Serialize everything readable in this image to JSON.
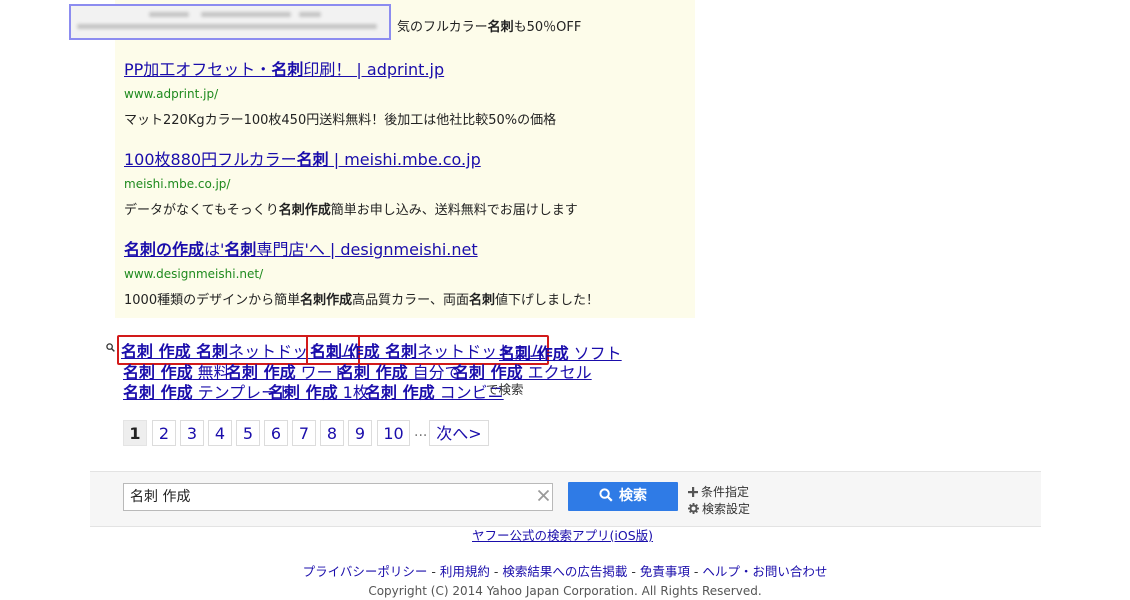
{
  "ads": {
    "first_tail": [
      "気のフルカラー",
      "名刺",
      "も50％OFF"
    ],
    "items": [
      {
        "title": [
          "PP加工オフセット・",
          "名刺",
          "印刷！ | adprint.jp"
        ],
        "url": "www.adprint.jp/",
        "desc": [
          "マット220Kgカラー100枚450円送料無料！後加工は他社比較50%の価格"
        ]
      },
      {
        "title": [
          "100枚880円フルカラー",
          "名刺",
          " | meishi.mbe.co.jp"
        ],
        "url": "meishi.mbe.co.jp/",
        "desc": [
          "データがなくてもそっくり",
          "名刺作成",
          "簡単お申し込み、送料無料でお届けします"
        ]
      },
      {
        "title": [
          "",
          "名刺の作成",
          "は'",
          "名刺",
          "専門店'へ | designmeishi.net"
        ],
        "url": "www.designmeishi.net/",
        "desc": [
          "1000種類のデザインから簡単",
          "名刺作成",
          "高品質カラー、両面",
          "名刺",
          "値下げしました！"
        ]
      }
    ]
  },
  "related": {
    "links": [
      {
        "bold": "名刺 作成 名刺",
        "rest": "ネットドットコム"
      },
      {
        "bold": "名刺 作成 名刺",
        "rest": "ネットドットコム"
      },
      {
        "bold": "名刺 作成",
        "rest": " ソフト"
      },
      {
        "bold": "名刺 作成",
        "rest": " 無料"
      },
      {
        "bold": "名刺 作成",
        "rest": " ワード"
      },
      {
        "bold": "名刺 作成",
        "rest": " 自分で"
      },
      {
        "bold": "名刺 作成",
        "rest": " エクセル"
      },
      {
        "bold": "名刺 作成",
        "rest": " テンプレート"
      },
      {
        "bold": "名刺 作成",
        "rest": " 1枚"
      },
      {
        "bold": "名刺 作成",
        "rest": " コンビニ"
      }
    ],
    "suffix": "で検索"
  },
  "pager": {
    "pages": [
      "1",
      "2",
      "3",
      "4",
      "5",
      "6",
      "7",
      "8",
      "9",
      "10"
    ],
    "current": "1",
    "dots": "...",
    "next": "次へ>"
  },
  "search": {
    "value": "名刺 作成",
    "button_label": "検索",
    "conditions_label": "条件指定",
    "settings_label": "検索設定",
    "accent_color": "#2f7be6"
  },
  "app_link": "ヤフー公式の検索アプリ(iOS版)",
  "footer": {
    "links": [
      "プライバシーポリシー",
      "利用規約",
      "検索結果への広告掲載",
      "免責事項",
      "ヘルプ・お問い合わせ"
    ],
    "separator": " - ",
    "copyright": "Copyright (C) 2014 Yahoo Japan Corporation. All Rights Reserved."
  },
  "colors": {
    "link": "#1a0dab",
    "url_green": "#1e8a1e",
    "highlight_border": "#d21a1a",
    "ad_background": "#fdfcea"
  }
}
